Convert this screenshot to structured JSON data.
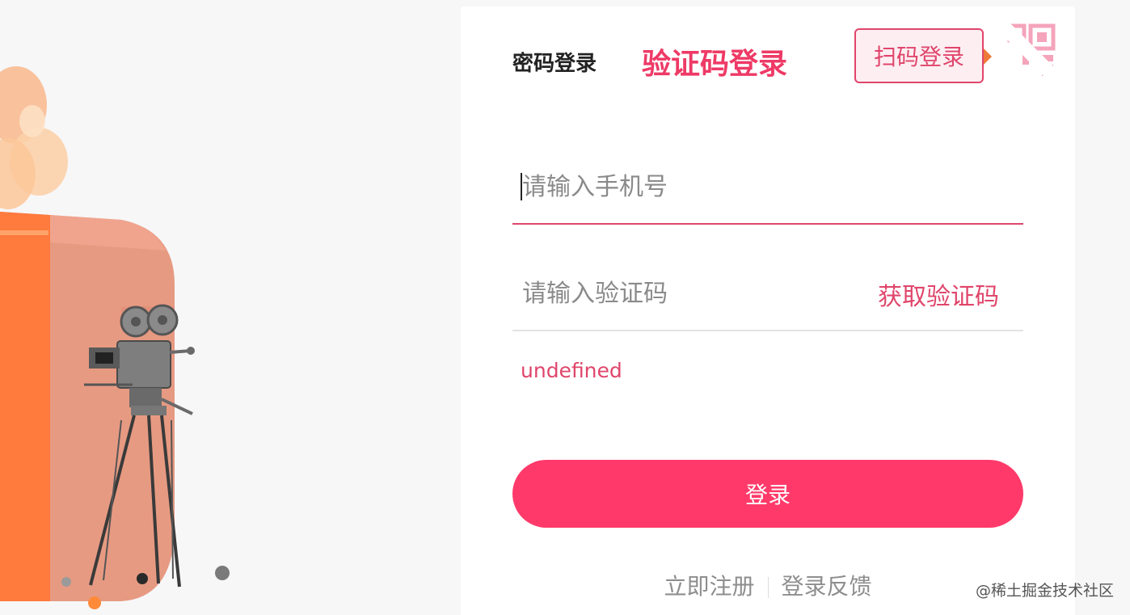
{
  "tabs": {
    "password_login": "密码登录",
    "code_login": "验证码登录"
  },
  "qr": {
    "label": "扫码登录"
  },
  "phone": {
    "placeholder": "请输入手机号",
    "value": ""
  },
  "code": {
    "placeholder": "请输入验证码",
    "value": "",
    "get_code_label": "获取验证码"
  },
  "error": {
    "message": "undefined"
  },
  "login_button": {
    "label": "登录"
  },
  "footer": {
    "register": "立即注册",
    "feedback": "登录反馈"
  },
  "watermark": "@稀土掘金技术社区",
  "colors": {
    "accent": "#ff3a6a",
    "accent_text": "#e0456b",
    "background": "#f7f7f8"
  },
  "icons": {
    "qr_corner": "qr-code-icon",
    "illustration": "gift-box-camera-illustration"
  }
}
